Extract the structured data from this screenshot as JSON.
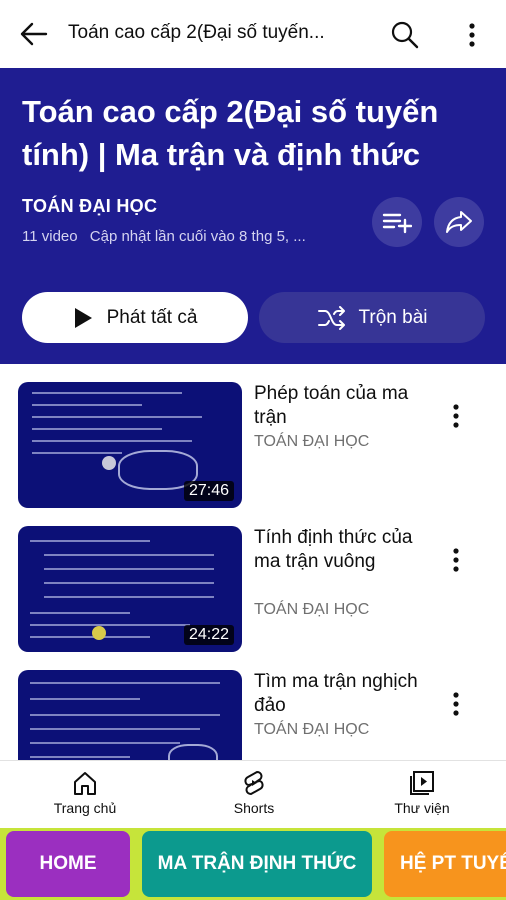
{
  "appbar": {
    "title": "Toán cao cấp 2(Đại số tuyến..."
  },
  "playlist": {
    "title": "Toán cao cấp 2(Đại số tuyến tính) | Ma trận và định thức",
    "channel": "TOÁN ĐẠI HỌC",
    "video_count": "11 video",
    "updated": "Cập nhật lần cuối vào 8 thg 5, ...",
    "play_all_label": "Phát tất cả",
    "shuffle_label": "Trộn bài",
    "banner_color": "#1f1d91"
  },
  "videos": [
    {
      "title": "Phép toán của ma trận",
      "channel": "TOÁN ĐẠI HỌC",
      "duration": "27:46"
    },
    {
      "title": "Tính định thức của ma trận vuông",
      "channel": "TOÁN ĐẠI HỌC",
      "duration": "24:22"
    },
    {
      "title": "Tìm ma trận nghịch đảo",
      "channel": "TOÁN ĐẠI HỌC",
      "duration": ""
    }
  ],
  "bottom_nav": [
    {
      "label": "Trang chủ",
      "icon": "home-icon"
    },
    {
      "label": "Shorts",
      "icon": "shorts-icon"
    },
    {
      "label": "Thư viện",
      "icon": "library-icon"
    }
  ],
  "categories": [
    {
      "label": "HOME",
      "color": "#9b2fc0"
    },
    {
      "label": "MA TRẬN ĐỊNH THỨC",
      "color": "#0c9a8e"
    },
    {
      "label": "HỆ PT TUYẾN",
      "color": "#f7941d"
    }
  ]
}
